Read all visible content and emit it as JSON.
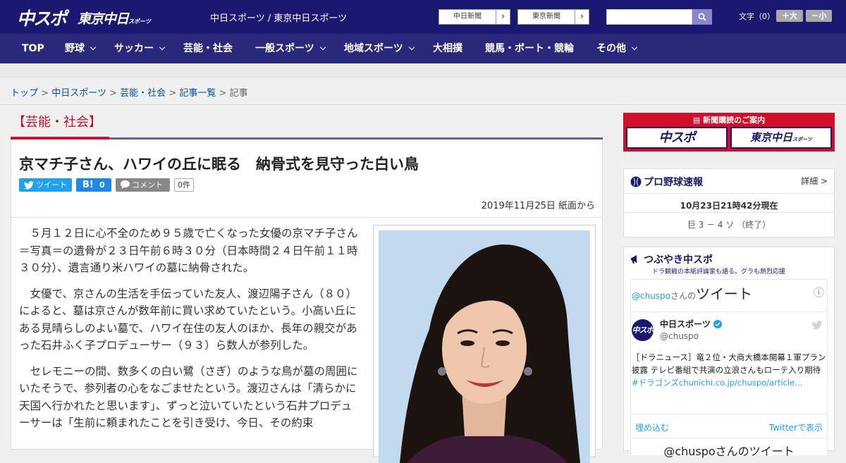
{
  "header": {
    "logo_main": "中スポ",
    "logo_tokyo": "東京中日",
    "logo_tokyo_small": "スポーツ",
    "tagline": "中日スポーツ / 東京中日スポーツ",
    "btn_chunichi": "中日新聞",
    "btn_tokyo": "東京新聞",
    "btn_arrow": "›",
    "search_placeholder": "",
    "font_size_label": "文字（0）",
    "font_bigger": "＋大",
    "font_smaller": "－小"
  },
  "nav": [
    {
      "label": "TOP"
    },
    {
      "label": "野球"
    },
    {
      "label": "サッカー"
    },
    {
      "label": "芸能・社会"
    },
    {
      "label": "一般スポーツ"
    },
    {
      "label": "地域スポーツ"
    },
    {
      "label": "大相撲"
    },
    {
      "label": "競馬・ボート・競輪"
    },
    {
      "label": "その他"
    }
  ],
  "breadcrumb": {
    "items": [
      "トップ",
      "中日スポーツ",
      "芸能・社会",
      "記事一覧"
    ],
    "current": "記事",
    "separator": ">"
  },
  "section": {
    "title": "【芸能・社会】"
  },
  "article": {
    "title": "京マチ子さん、ハワイの丘に眠る　納骨式を見守った白い鳥",
    "share_tweet": "ツイート",
    "share_hatena": "B!",
    "share_hatena_count": "0",
    "share_comment": "コメント",
    "comment_count": "0件",
    "date": "2019年11月25日 紙面から",
    "paragraphs": [
      "５月１２日に心不全のため９５歳で亡くなった女優の京マチ子さん＝写真＝の遺骨が２３日午前６時３０分（日本時間２４日午前１１時３０分）、遺言通り米ハワイの墓に納骨された。",
      "女優で、京さんの生活を手伝っていた友人、渡辺陽子さん（８０）によると、墓は京さんが数年前に買い求めていたという。小高い丘にある見晴らしのよい墓で、ハワイ在住の友人のほか、長年の親交があった石井ふく子プロデューサー（９３）ら数人が参列した。",
      "セレモニーの間、数多くの白い鷺（さぎ）のような鳥が墓の周囲にいたそうで、参列者の心をなごませたという。渡辺さんは「清らかに天国へ行かれたと思います」、ずっと泣いていたという石井プロデューサーは「生前に頼まれたことを引き受け、今日、その約束"
    ]
  },
  "sidebar": {
    "subscribe": {
      "title": "新聞購読のご案内",
      "logo_left": "中スポ",
      "logo_right": "東京中日",
      "logo_right_small": "スポーツ"
    },
    "baseball": {
      "title": "プロ野球速報",
      "detail": "詳細 >",
      "updated": "10月23日21時42分現在",
      "score": "巨 3 － 4 ソ （終了）"
    },
    "twitter": {
      "title": "つぶやき中スポ",
      "subtitle": "ドラ観戦の本紙評論家も語る。グラも熱烈応援",
      "handle_prefix": "@chuspo",
      "handle_suffix": "さんの",
      "tweets_word": "ツイート",
      "info": "ⓘ",
      "user_name": "中日スポーツ",
      "user_handle": "@chuspo",
      "tweet_text": "［ドラニュース］竜２位・大商大橋本開幕１軍プラン披露 テレビ番組で共演の立浪さんもローテ入り期待",
      "tweet_link": "#ドラゴンズchunichi.co.jp/chuspo/article…",
      "embed": "埋め込む",
      "view_on_twitter": "Twitterで表示",
      "footer_partial": "@chuspoさんのツイート"
    }
  },
  "colors": {
    "header_bg": "#1a1870",
    "nav_bg": "#2a287a",
    "accent_red": "#d0102a",
    "accent_purple": "#6b5ba6",
    "link": "#0050a0",
    "twitter": "#1da1f2"
  }
}
